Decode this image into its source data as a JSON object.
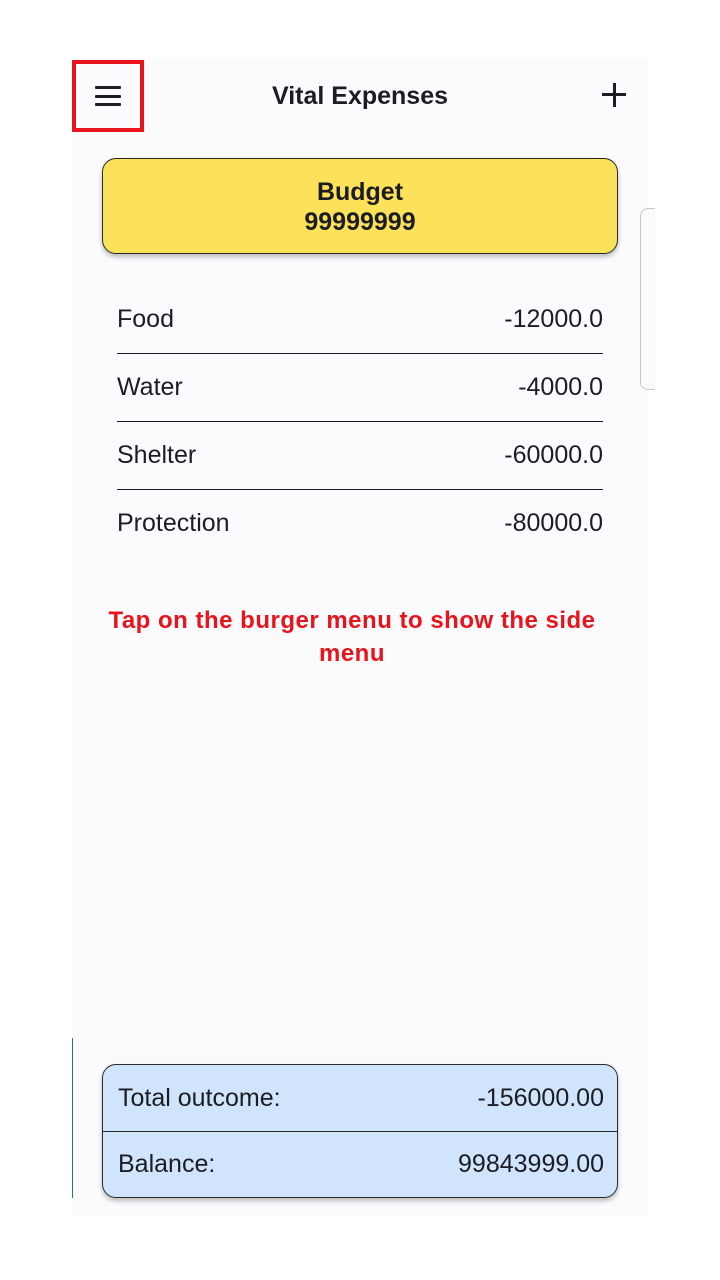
{
  "header": {
    "title": "Vital Expenses",
    "menu_icon": "hamburger-menu-icon",
    "add_icon": "plus-icon"
  },
  "budget": {
    "label": "Budget",
    "value": "99999999"
  },
  "expenses": [
    {
      "name": "Food",
      "amount": "-12000.0"
    },
    {
      "name": "Water",
      "amount": "-4000.0"
    },
    {
      "name": "Shelter",
      "amount": "-60000.0"
    },
    {
      "name": "Protection",
      "amount": "-80000.0"
    }
  ],
  "hint": "Tap on the burger menu to show the side menu",
  "summary": {
    "total_label": "Total outcome:",
    "total_value": "-156000.00",
    "balance_label": "Balance:",
    "balance_value": "99843999.00"
  },
  "colors": {
    "budget_bg": "#fce15a",
    "summary_bg": "#d0e4fc",
    "highlight": "#e8141c"
  }
}
